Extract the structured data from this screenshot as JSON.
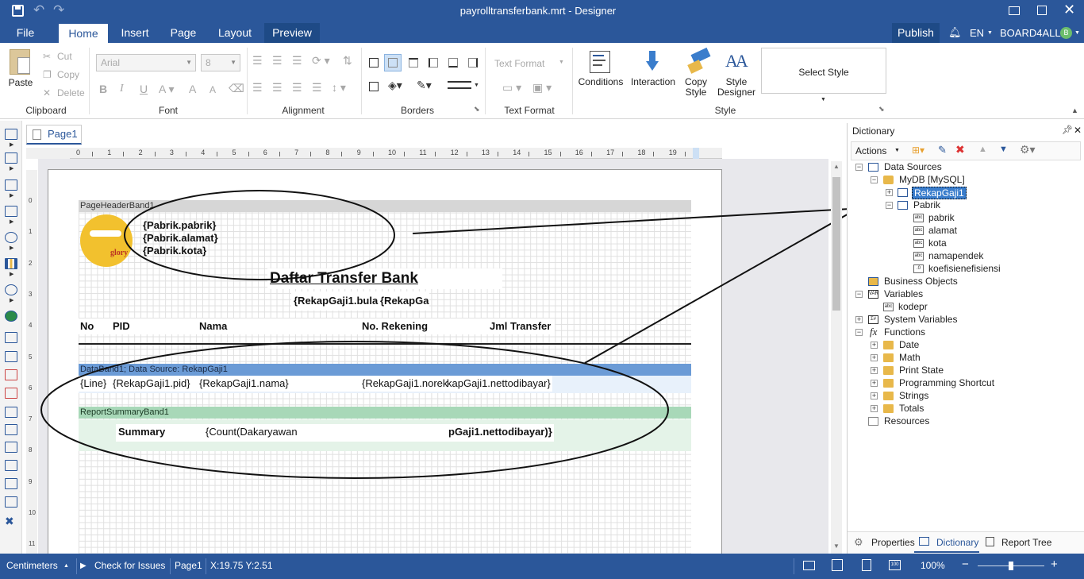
{
  "title_bar": {
    "title": "payrolltransferbank.mrt - Designer"
  },
  "menu": {
    "file": "File",
    "home": "Home",
    "insert": "Insert",
    "page": "Page",
    "layout": "Layout",
    "preview": "Preview",
    "publish": "Publish",
    "language": "EN",
    "user": "BOARD4ALL",
    "user_initial": "B"
  },
  "ribbon": {
    "clipboard": {
      "paste": "Paste",
      "cut": "Cut",
      "copy": "Copy",
      "delete": "Delete",
      "label": "Clipboard"
    },
    "font": {
      "family": "Arial",
      "size": "8",
      "label": "Font",
      "bold": "B",
      "italic": "I",
      "underline": "U",
      "grow": "A",
      "shrink": "A"
    },
    "alignment": {
      "label": "Alignment"
    },
    "borders": {
      "label": "Borders"
    },
    "text_format": {
      "combo": "Text Format",
      "label": "Text Format"
    },
    "style": {
      "conditions": "Conditions",
      "interaction": "Interaction",
      "copy_style_1": "Copy",
      "copy_style_2": "Style",
      "style_designer_1": "Style",
      "style_designer_2": "Designer",
      "select_style": "Select Style",
      "label": "Style"
    }
  },
  "document": {
    "page_tab": "Page1"
  },
  "ruler": {
    "h_ticks": [
      "0",
      "1",
      "2",
      "3",
      "4",
      "5",
      "6",
      "7",
      "8",
      "9",
      "10",
      "11",
      "12",
      "13",
      "14",
      "15",
      "16",
      "17",
      "18",
      "19"
    ],
    "v_ticks": [
      "0",
      "1",
      "2",
      "3",
      "4",
      "5",
      "6",
      "7",
      "8",
      "9",
      "10",
      "11"
    ]
  },
  "report": {
    "page_header_band": "PageHeaderBand1",
    "logo_text": "glory",
    "pabrik_fields": [
      "{Pabrik.pabrik}",
      "{Pabrik.alamat}",
      "{Pabrik.kota}"
    ],
    "report_title": "Daftar Transfer Bank",
    "period": "{RekapGaji1.bula",
    "period2": "{RekapGa",
    "columns": [
      "No",
      "PID",
      "Nama",
      "No. Rekening",
      "Jml Transfer"
    ],
    "data_band": "DataBand1; Data Source: RekapGaji1",
    "data_fields": [
      "{Line}",
      "{RekapGaji1.pid}",
      "{RekapGaji1.nama}",
      "{RekapGaji1.norek",
      "kapGaji1.nettodibayar}"
    ],
    "summary_band": "ReportSummaryBand1",
    "summary_label": "Summary",
    "summary_count": "{Count(Da",
    "summary_count2": "karyawan",
    "summary_total": "pGaji1.nettodibayar)}"
  },
  "dictionary": {
    "title": "Dictionary",
    "actions": "Actions",
    "tree": {
      "data_sources": "Data Sources",
      "mydb": "MyDB [MySQL]",
      "rekapgaji1": "RekapGaji1",
      "pabrik": "Pabrik",
      "pabrik_cols": [
        "pabrik",
        "alamat",
        "kota",
        "namapendek",
        "koefisienefisiensi"
      ],
      "business_objects": "Business Objects",
      "variables": "Variables",
      "kodepr": "kodepr",
      "system_variables": "System Variables",
      "functions": "Functions",
      "function_groups": [
        "Date",
        "Math",
        "Print State",
        "Programming Shortcut",
        "Strings",
        "Totals"
      ],
      "resources": "Resources"
    },
    "tabs": {
      "properties": "Properties",
      "dictionary": "Dictionary",
      "report_tree": "Report Tree"
    }
  },
  "status": {
    "units": "Centimeters",
    "check": "Check for Issues",
    "page": "Page1",
    "coords": "X:19.75 Y:2.51",
    "zoom": "100%",
    "zoom_level": 0.5
  },
  "colors": {
    "accent": "#2b579a",
    "databand": "#6b9bd6",
    "summaryband": "#a8d8b8",
    "folder": "#e8b84a"
  }
}
